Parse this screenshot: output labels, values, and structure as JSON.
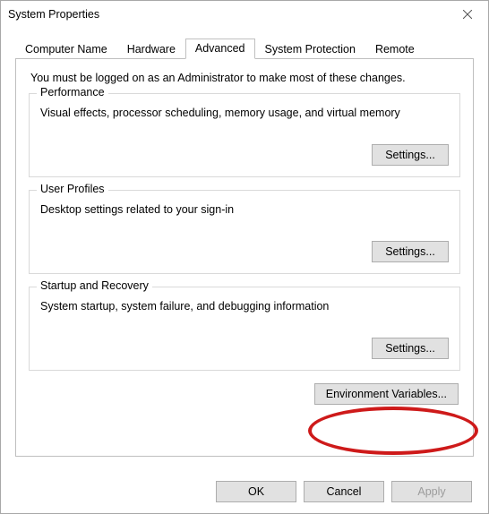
{
  "window": {
    "title": "System Properties"
  },
  "tabs": {
    "computer_name": "Computer Name",
    "hardware": "Hardware",
    "advanced": "Advanced",
    "system_protection": "System Protection",
    "remote": "Remote",
    "active": "advanced"
  },
  "advanced": {
    "intro": "You must be logged on as an Administrator to make most of these changes.",
    "performance": {
      "legend": "Performance",
      "desc": "Visual effects, processor scheduling, memory usage, and virtual memory",
      "settings_label": "Settings..."
    },
    "user_profiles": {
      "legend": "User Profiles",
      "desc": "Desktop settings related to your sign-in",
      "settings_label": "Settings..."
    },
    "startup_recovery": {
      "legend": "Startup and Recovery",
      "desc": "System startup, system failure, and debugging information",
      "settings_label": "Settings..."
    },
    "env_vars_label": "Environment Variables..."
  },
  "footer": {
    "ok": "OK",
    "cancel": "Cancel",
    "apply": "Apply"
  }
}
